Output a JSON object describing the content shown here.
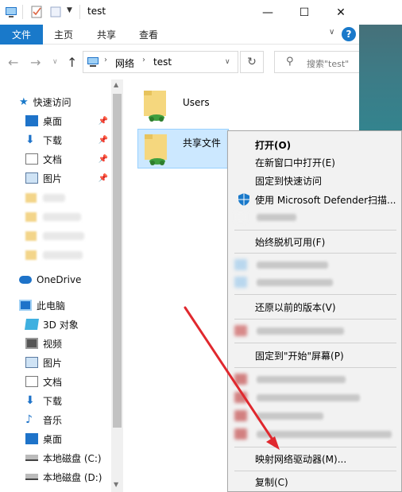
{
  "window": {
    "title": "test",
    "minimize": "—",
    "maximize": "☐",
    "close": "✕"
  },
  "ribbon": {
    "tabs": [
      {
        "label": "文件"
      },
      {
        "label": "主页"
      },
      {
        "label": "共享"
      },
      {
        "label": "查看"
      }
    ],
    "help": "?"
  },
  "address": {
    "breadcrumb": [
      "网络",
      "test"
    ],
    "search_placeholder": "搜索\"test\""
  },
  "nav": {
    "quick_access": "快速访问",
    "pinned": [
      {
        "label": "桌面",
        "icon": "desktop-icon"
      },
      {
        "label": "下载",
        "icon": "download-icon"
      },
      {
        "label": "文档",
        "icon": "document-icon"
      },
      {
        "label": "图片",
        "icon": "pictures-icon"
      }
    ],
    "onedrive": "OneDrive",
    "this_pc": "此电脑",
    "pc_items": [
      {
        "label": "3D 对象",
        "icon": "3d-objects-icon"
      },
      {
        "label": "视频",
        "icon": "video-icon"
      },
      {
        "label": "图片",
        "icon": "pictures-icon"
      },
      {
        "label": "文档",
        "icon": "document-icon"
      },
      {
        "label": "下载",
        "icon": "download-icon"
      },
      {
        "label": "音乐",
        "icon": "music-icon"
      },
      {
        "label": "桌面",
        "icon": "desktop-icon"
      },
      {
        "label": "本地磁盘 (C:)",
        "icon": "drive-icon"
      },
      {
        "label": "本地磁盘 (D:)",
        "icon": "drive-icon"
      }
    ]
  },
  "folders": [
    {
      "name": "Users"
    },
    {
      "name": "共享文件"
    }
  ],
  "context_menu": {
    "open": "打开(O)",
    "open_new_window": "在新窗口中打开(E)",
    "pin_quick_access": "固定到快速访问",
    "defender": "使用 Microsoft Defender扫描...",
    "always_offline": "始终脱机可用(F)",
    "restore_previous": "还原以前的版本(V)",
    "pin_start": "固定到\"开始\"屏幕(P)",
    "map_drive": "映射网络驱动器(M)...",
    "copy": "复制(C)"
  },
  "colors": {
    "accent": "#1979ca",
    "selection": "#cce8ff",
    "arrow": "#e0282e"
  }
}
